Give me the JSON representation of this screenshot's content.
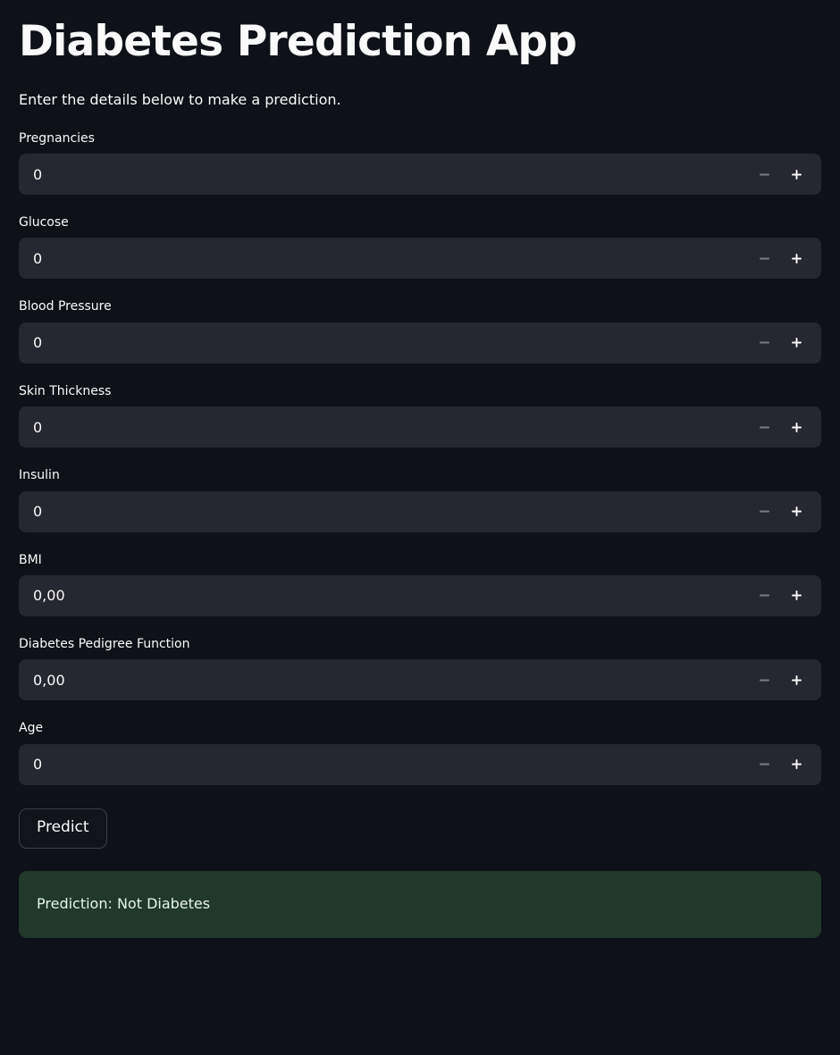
{
  "header": {
    "title": "Diabetes Prediction App",
    "caption": "Enter the details below to make a prediction."
  },
  "fields": [
    {
      "label": "Pregnancies",
      "value": "0",
      "decrement_icon": "minus-icon",
      "increment_icon": "plus-icon"
    },
    {
      "label": "Glucose",
      "value": "0",
      "decrement_icon": "minus-icon",
      "increment_icon": "plus-icon"
    },
    {
      "label": "Blood Pressure",
      "value": "0",
      "decrement_icon": "minus-icon",
      "increment_icon": "plus-icon"
    },
    {
      "label": "Skin Thickness",
      "value": "0",
      "decrement_icon": "minus-icon",
      "increment_icon": "plus-icon"
    },
    {
      "label": "Insulin",
      "value": "0",
      "decrement_icon": "minus-icon",
      "increment_icon": "plus-icon"
    },
    {
      "label": "BMI",
      "value": "0,00",
      "decrement_icon": "minus-icon",
      "increment_icon": "plus-icon"
    },
    {
      "label": "Diabetes Pedigree Function",
      "value": "0,00",
      "decrement_icon": "minus-icon",
      "increment_icon": "plus-icon"
    },
    {
      "label": "Age",
      "value": "0",
      "decrement_icon": "minus-icon",
      "increment_icon": "plus-icon"
    }
  ],
  "actions": {
    "predict_label": "Predict"
  },
  "result": {
    "text": "Prediction: Not Diabetes",
    "status": "success"
  },
  "colors": {
    "background": "#0e1117",
    "input_background": "#262730",
    "text": "#fafafa",
    "success_background": "#21382b",
    "success_text": "#e8f3ec",
    "button_border": "#3c3f48",
    "stepper_disabled": "#7a7c87"
  }
}
